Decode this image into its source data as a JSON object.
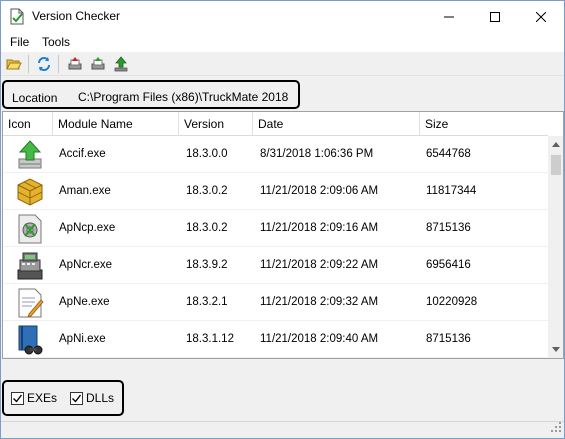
{
  "window": {
    "title": "Version Checker"
  },
  "menu": {
    "items": [
      {
        "label": "File"
      },
      {
        "label": "Tools"
      }
    ]
  },
  "toolbar": {
    "buttons": [
      {
        "icon": "folder-open-icon"
      },
      {
        "icon": "refresh-icon"
      },
      {
        "icon": "print-red-icon"
      },
      {
        "icon": "print-green-icon"
      },
      {
        "icon": "tree-arrow-icon"
      }
    ]
  },
  "location": {
    "label": "Location",
    "value": "C:\\Program Files (x86)\\TruckMate 2018"
  },
  "table": {
    "columns": [
      "Icon",
      "Module Name",
      "Version",
      "Date",
      "Size"
    ],
    "rows": [
      {
        "icon": "green-arrow-server-icon",
        "module": "Accif.exe",
        "version": "18.3.0.0",
        "date": "8/31/2018 1:06:36 PM",
        "size": "6544768"
      },
      {
        "icon": "gold-cubes-icon",
        "module": "Aman.exe",
        "version": "18.3.0.2",
        "date": "11/21/2018 2:09:06 AM",
        "size": "11817344"
      },
      {
        "icon": "gear-document-icon",
        "module": "ApNcp.exe",
        "version": "18.3.0.2",
        "date": "11/21/2018 2:09:16 AM",
        "size": "8715136"
      },
      {
        "icon": "cash-register-icon",
        "module": "ApNcr.exe",
        "version": "18.3.9.2",
        "date": "11/21/2018 2:09:22 AM",
        "size": "6956416"
      },
      {
        "icon": "notepad-pencil-icon",
        "module": "ApNe.exe",
        "version": "18.3.2.1",
        "date": "11/21/2018 2:09:32 AM",
        "size": "10220928"
      },
      {
        "icon": "blue-book-binoculars-icon",
        "module": "ApNi.exe",
        "version": "18.3.1.12",
        "date": "11/21/2018 2:09:40 AM",
        "size": "8715136"
      }
    ]
  },
  "options": {
    "exes_label": "EXEs",
    "exes_checked": true,
    "dlls_label": "DLLs",
    "dlls_checked": true
  }
}
